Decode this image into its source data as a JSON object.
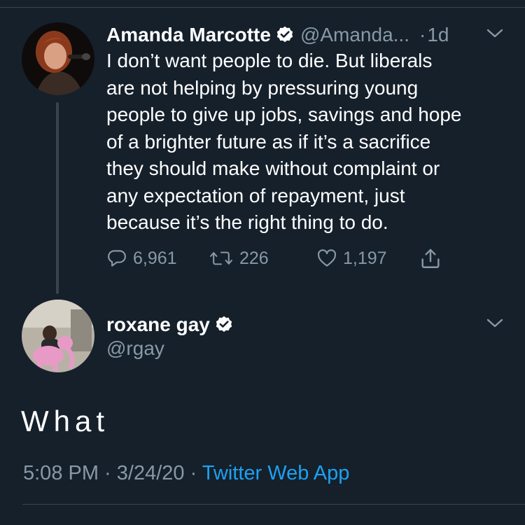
{
  "colors": {
    "background": "#15202b",
    "text": "#ffffff",
    "muted": "#8899a6",
    "accent": "#1da1f2",
    "divider": "#38444d"
  },
  "tweet1": {
    "name": "Amanda Marcotte",
    "handle": "@Amanda...",
    "dot": "·",
    "time": "1d",
    "text_lines": [
      "I don’t want people to die. But liberals",
      "are not helping by pressuring young",
      "people to give up jobs, savings and hope",
      "of a brighter future as if it’s a sacrifice",
      "they should make without complaint or",
      "any expectation of repayment, just",
      "because it’s the right thing to do."
    ],
    "actions": {
      "replies": "6,961",
      "retweets": "226",
      "likes": "1,197"
    },
    "icons": [
      "reply-icon",
      "retweet-icon",
      "like-icon",
      "share-icon",
      "verified-badge-icon",
      "chevron-down-icon"
    ]
  },
  "tweet2": {
    "name": "roxane gay",
    "handle": "@rgay",
    "text": "What",
    "timestamp": "5:08 PM · 3/24/20 · ",
    "source": "Twitter Web App"
  }
}
